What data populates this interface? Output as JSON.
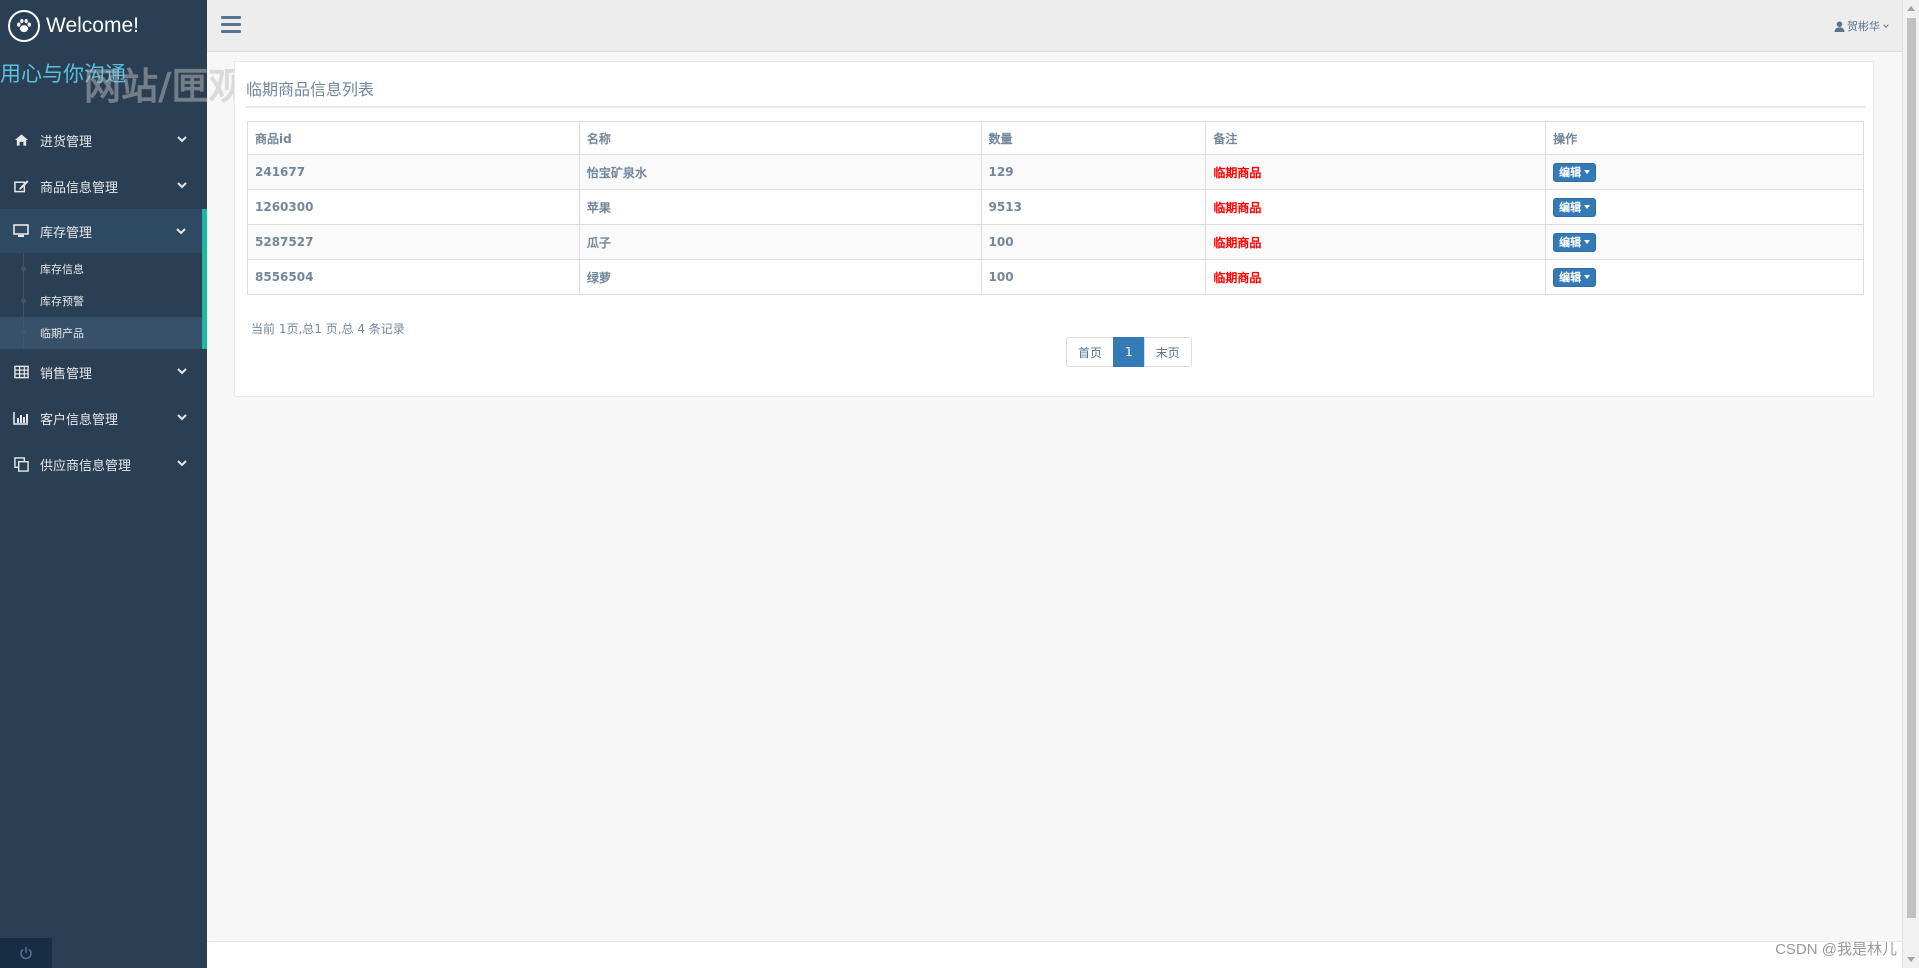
{
  "brand": {
    "title": "Welcome!",
    "tagline": "用心与你沟通",
    "watermark": "网站/匣观宣"
  },
  "sidebar": {
    "menu": [
      {
        "label": "进货管理",
        "icon": "home-icon"
      },
      {
        "label": "商品信息管理",
        "icon": "edit-icon"
      },
      {
        "label": "库存管理",
        "icon": "desktop-icon"
      },
      {
        "label": "销售管理",
        "icon": "table-icon"
      },
      {
        "label": "客户信息管理",
        "icon": "bar-chart-icon"
      },
      {
        "label": "供应商信息管理",
        "icon": "clone-icon"
      }
    ],
    "submenu": [
      {
        "label": "库存信息"
      },
      {
        "label": "库存预警"
      },
      {
        "label": "临期产品"
      }
    ]
  },
  "topnav": {
    "user": "贺彬华"
  },
  "panel": {
    "title": "临期商品信息列表"
  },
  "table": {
    "headers": [
      "商品id",
      "名称",
      "数量",
      "备注",
      "操作"
    ],
    "rows": [
      {
        "id": "241677",
        "name": "怡宝矿泉水",
        "qty": "129",
        "remark": "临期商品",
        "action": "编辑"
      },
      {
        "id": "1260300",
        "name": "苹果",
        "qty": "9513",
        "remark": "临期商品",
        "action": "编辑"
      },
      {
        "id": "5287527",
        "name": "瓜子",
        "qty": "100",
        "remark": "临期商品",
        "action": "编辑"
      },
      {
        "id": "8556504",
        "name": "绿萝",
        "qty": "100",
        "remark": "临期商品",
        "action": "编辑"
      }
    ]
  },
  "pagination": {
    "info": "当前 1页,总1 页,总 4 条记录",
    "first": "首页",
    "current": "1",
    "last": "末页"
  },
  "footer": {
    "credit": "CSDN @我是林儿"
  },
  "colors": {
    "sidebar": "#2a3f54",
    "accent": "#1abb9c",
    "primary": "#337ab7",
    "remark": "#ff0000"
  }
}
